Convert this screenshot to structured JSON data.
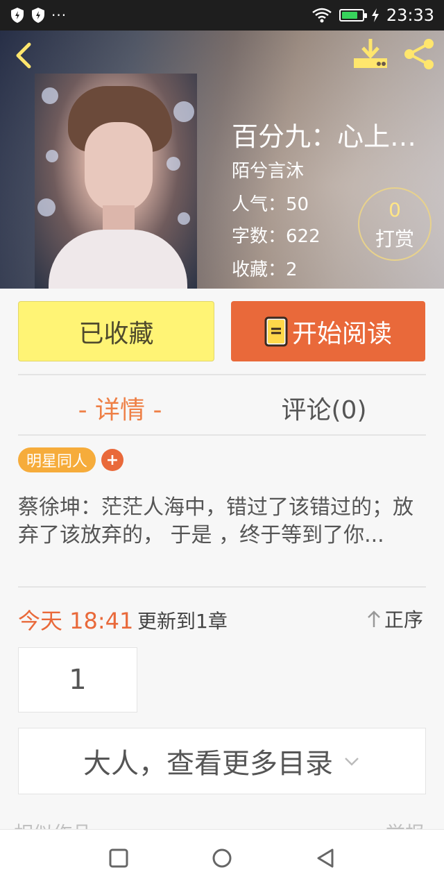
{
  "status_bar": {
    "time": "23:33",
    "battery_level": 0.8,
    "icons": [
      "shield-icon",
      "shield-icon",
      "more-dots-icon",
      "wifi-icon",
      "battery-icon",
      "charging-icon"
    ],
    "dots": "···"
  },
  "header": {
    "icons": [
      "back-icon",
      "download-icon",
      "share-icon"
    ],
    "book": {
      "title": "百分九：心上…",
      "author": "陌兮言沐",
      "popularity": "人气：50",
      "word_count": "字数：622",
      "favorites": "收藏：2"
    },
    "reward": {
      "count": "0",
      "label": "打赏"
    }
  },
  "actions": {
    "collected_label": "已收藏",
    "read_label": "开始阅读"
  },
  "tabs": [
    {
      "label": "- 详情 -",
      "active": true
    },
    {
      "label": "评论(0)",
      "active": false
    }
  ],
  "tag": {
    "label": "明星同人",
    "add_label": "+"
  },
  "synopsis": "蔡徐坤：茫茫人海中，错过了该错过的；放弃了该放弃的， 于是 ，终于等到了你...",
  "update": {
    "time": "今天 18:41",
    "text": "更新到1章",
    "sort_label": "正序"
  },
  "chapters": [
    "1"
  ],
  "more_catalog_label": "大人，查看更多目录",
  "similar": {
    "label": "相似作品",
    "right": "举报"
  },
  "nav_bar": [
    "recent-apps-icon",
    "home-icon",
    "back-nav-icon"
  ],
  "colors": {
    "accent": "#e9693a",
    "collected_bg": "#fff475",
    "tag_bg": "#f6ac3b",
    "tab_active": "#ee7f45"
  }
}
